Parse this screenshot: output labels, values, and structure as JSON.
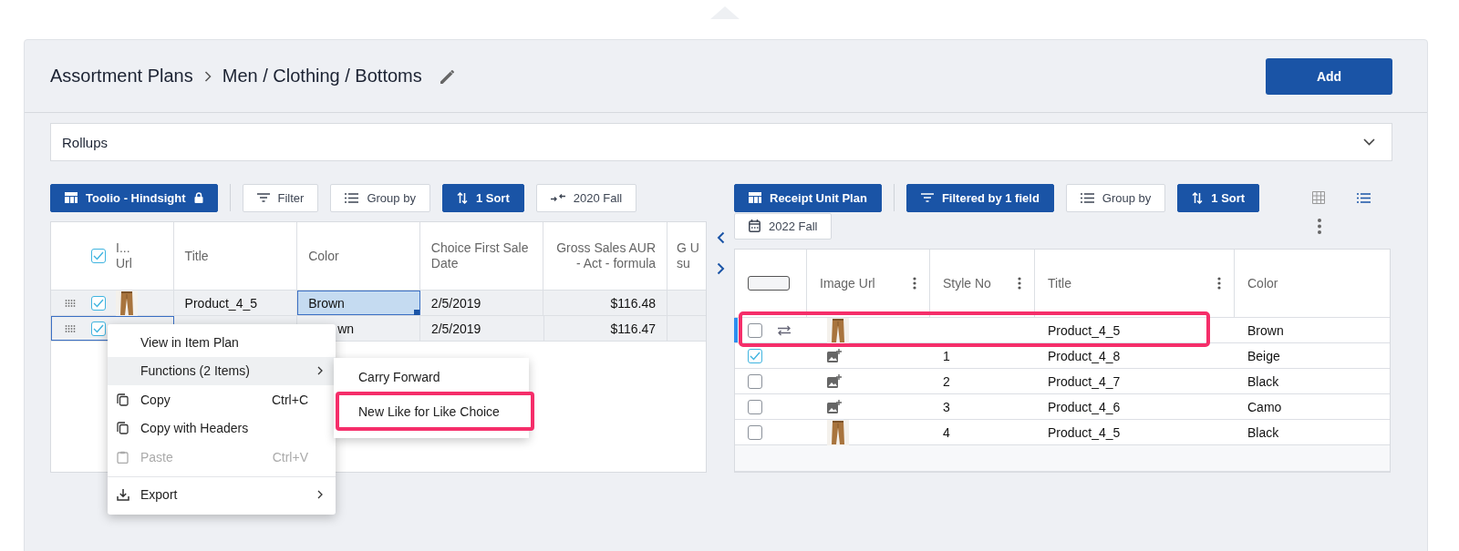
{
  "header": {
    "breadcrumb": [
      "Assortment Plans",
      "Men / Clothing / Bottoms"
    ],
    "add_button": "Add"
  },
  "rollups": {
    "label": "Rollups",
    "expanded": false
  },
  "left_toolbar": [
    {
      "label": "Toolio - Hindsight",
      "kind": "view",
      "filled": true,
      "locked": true
    },
    {
      "label": "Filter",
      "kind": "filter",
      "filled": false,
      "locked": false
    },
    {
      "label": "Group by",
      "kind": "group",
      "filled": false,
      "locked": false
    },
    {
      "label": "1 Sort",
      "kind": "sort",
      "filled": true,
      "locked": false
    },
    {
      "label": "2020 Fall",
      "kind": "compare",
      "filled": false,
      "locked": false
    }
  ],
  "left_grid": {
    "all_checked": true,
    "lead_column": "I... Url",
    "columns": [
      "Title",
      "Color",
      "Choice First Sale Date",
      "Gross Sales AUR - Act - formula",
      "G U su"
    ],
    "rows": [
      {
        "checked": true,
        "image": true,
        "focused": false,
        "cells": [
          {
            "text": "Product_4_5",
            "selected": false
          },
          {
            "text": "Brown",
            "selected": true
          },
          {
            "text": "2/5/2019",
            "selected": false
          },
          {
            "text": "$116.48",
            "selected": false
          }
        ]
      },
      {
        "checked": true,
        "image": false,
        "focused": true,
        "cells": [
          {
            "text": "",
            "selected": false
          },
          {
            "text": "wn",
            "selected": false
          },
          {
            "text": "2/5/2019",
            "selected": false
          },
          {
            "text": "$116.47",
            "selected": false
          }
        ]
      }
    ]
  },
  "context_menu": [
    {
      "label": "View in Item Plan",
      "kind": "plain",
      "selected": false,
      "disabled": false
    },
    {
      "label": "Functions (2 Items)",
      "kind": "submenu",
      "selected": true,
      "disabled": false
    },
    {
      "label": "Copy",
      "kind": "copy",
      "shortcut": "Ctrl+C",
      "selected": false,
      "disabled": false
    },
    {
      "label": "Copy with Headers",
      "kind": "copy",
      "selected": false,
      "disabled": false
    },
    {
      "label": "Paste",
      "kind": "paste",
      "shortcut": "Ctrl+V",
      "selected": false,
      "disabled": true
    },
    {
      "label": "Export",
      "kind": "export",
      "selected": false,
      "disabled": false
    }
  ],
  "submenu": [
    {
      "label": "Carry Forward",
      "highlighted": false
    },
    {
      "label": "New Like for Like Choice",
      "highlighted": true
    }
  ],
  "right_toolbar": [
    {
      "label": "Receipt Unit Plan",
      "kind": "view",
      "filled": true,
      "locked": false
    },
    {
      "label": "Filtered by 1 field",
      "kind": "filter",
      "filled": true,
      "locked": false
    },
    {
      "label": "Group by",
      "kind": "group",
      "filled": false,
      "locked": false
    },
    {
      "label": "1 Sort",
      "kind": "sort",
      "filled": true,
      "locked": false
    },
    {
      "label": "2022 Fall",
      "kind": "calendar",
      "filled": false,
      "locked": false
    }
  ],
  "right_grid": {
    "header_partial": true,
    "image_column": "Image Url",
    "columns": [
      "Style No",
      "Title",
      "Color"
    ],
    "rows": [
      {
        "checked": false,
        "linked": true,
        "active": true,
        "highlighted": true,
        "cells": [
          "",
          "Product_4_5",
          "Brown"
        ]
      },
      {
        "checked": true,
        "linked": false,
        "active": false,
        "highlighted": false,
        "kind": "placeholder",
        "cells": [
          "1",
          "Product_4_8",
          "Beige"
        ]
      },
      {
        "checked": false,
        "linked": false,
        "active": false,
        "highlighted": false,
        "kind": "placeholder",
        "cells": [
          "2",
          "Product_4_7",
          "Black"
        ]
      },
      {
        "checked": false,
        "linked": false,
        "active": false,
        "highlighted": false,
        "kind": "placeholder",
        "cells": [
          "3",
          "Product_4_6",
          "Camo"
        ]
      },
      {
        "checked": false,
        "linked": false,
        "active": false,
        "highlighted": false,
        "cells": [
          "4",
          "Product_4_5",
          "Black"
        ]
      }
    ]
  }
}
